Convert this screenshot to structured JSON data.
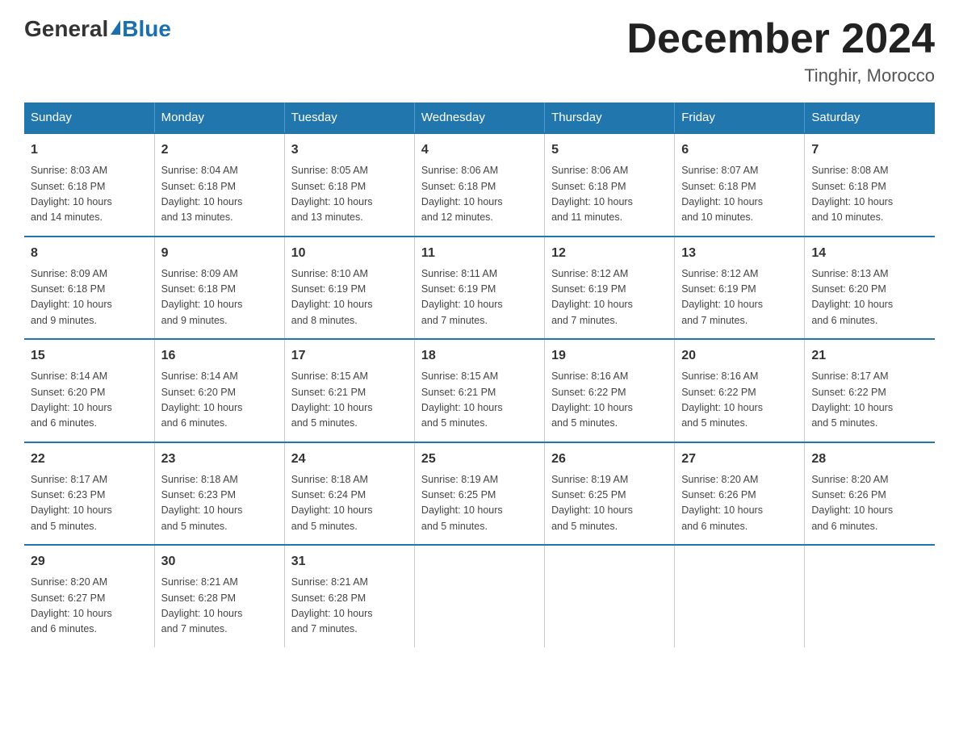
{
  "header": {
    "logo_general": "General",
    "logo_blue": "Blue",
    "month_title": "December 2024",
    "location": "Tinghir, Morocco"
  },
  "weekdays": [
    "Sunday",
    "Monday",
    "Tuesday",
    "Wednesday",
    "Thursday",
    "Friday",
    "Saturday"
  ],
  "weeks": [
    [
      {
        "day": "1",
        "info": "Sunrise: 8:03 AM\nSunset: 6:18 PM\nDaylight: 10 hours\nand 14 minutes."
      },
      {
        "day": "2",
        "info": "Sunrise: 8:04 AM\nSunset: 6:18 PM\nDaylight: 10 hours\nand 13 minutes."
      },
      {
        "day": "3",
        "info": "Sunrise: 8:05 AM\nSunset: 6:18 PM\nDaylight: 10 hours\nand 13 minutes."
      },
      {
        "day": "4",
        "info": "Sunrise: 8:06 AM\nSunset: 6:18 PM\nDaylight: 10 hours\nand 12 minutes."
      },
      {
        "day": "5",
        "info": "Sunrise: 8:06 AM\nSunset: 6:18 PM\nDaylight: 10 hours\nand 11 minutes."
      },
      {
        "day": "6",
        "info": "Sunrise: 8:07 AM\nSunset: 6:18 PM\nDaylight: 10 hours\nand 10 minutes."
      },
      {
        "day": "7",
        "info": "Sunrise: 8:08 AM\nSunset: 6:18 PM\nDaylight: 10 hours\nand 10 minutes."
      }
    ],
    [
      {
        "day": "8",
        "info": "Sunrise: 8:09 AM\nSunset: 6:18 PM\nDaylight: 10 hours\nand 9 minutes."
      },
      {
        "day": "9",
        "info": "Sunrise: 8:09 AM\nSunset: 6:18 PM\nDaylight: 10 hours\nand 9 minutes."
      },
      {
        "day": "10",
        "info": "Sunrise: 8:10 AM\nSunset: 6:19 PM\nDaylight: 10 hours\nand 8 minutes."
      },
      {
        "day": "11",
        "info": "Sunrise: 8:11 AM\nSunset: 6:19 PM\nDaylight: 10 hours\nand 7 minutes."
      },
      {
        "day": "12",
        "info": "Sunrise: 8:12 AM\nSunset: 6:19 PM\nDaylight: 10 hours\nand 7 minutes."
      },
      {
        "day": "13",
        "info": "Sunrise: 8:12 AM\nSunset: 6:19 PM\nDaylight: 10 hours\nand 7 minutes."
      },
      {
        "day": "14",
        "info": "Sunrise: 8:13 AM\nSunset: 6:20 PM\nDaylight: 10 hours\nand 6 minutes."
      }
    ],
    [
      {
        "day": "15",
        "info": "Sunrise: 8:14 AM\nSunset: 6:20 PM\nDaylight: 10 hours\nand 6 minutes."
      },
      {
        "day": "16",
        "info": "Sunrise: 8:14 AM\nSunset: 6:20 PM\nDaylight: 10 hours\nand 6 minutes."
      },
      {
        "day": "17",
        "info": "Sunrise: 8:15 AM\nSunset: 6:21 PM\nDaylight: 10 hours\nand 5 minutes."
      },
      {
        "day": "18",
        "info": "Sunrise: 8:15 AM\nSunset: 6:21 PM\nDaylight: 10 hours\nand 5 minutes."
      },
      {
        "day": "19",
        "info": "Sunrise: 8:16 AM\nSunset: 6:22 PM\nDaylight: 10 hours\nand 5 minutes."
      },
      {
        "day": "20",
        "info": "Sunrise: 8:16 AM\nSunset: 6:22 PM\nDaylight: 10 hours\nand 5 minutes."
      },
      {
        "day": "21",
        "info": "Sunrise: 8:17 AM\nSunset: 6:22 PM\nDaylight: 10 hours\nand 5 minutes."
      }
    ],
    [
      {
        "day": "22",
        "info": "Sunrise: 8:17 AM\nSunset: 6:23 PM\nDaylight: 10 hours\nand 5 minutes."
      },
      {
        "day": "23",
        "info": "Sunrise: 8:18 AM\nSunset: 6:23 PM\nDaylight: 10 hours\nand 5 minutes."
      },
      {
        "day": "24",
        "info": "Sunrise: 8:18 AM\nSunset: 6:24 PM\nDaylight: 10 hours\nand 5 minutes."
      },
      {
        "day": "25",
        "info": "Sunrise: 8:19 AM\nSunset: 6:25 PM\nDaylight: 10 hours\nand 5 minutes."
      },
      {
        "day": "26",
        "info": "Sunrise: 8:19 AM\nSunset: 6:25 PM\nDaylight: 10 hours\nand 5 minutes."
      },
      {
        "day": "27",
        "info": "Sunrise: 8:20 AM\nSunset: 6:26 PM\nDaylight: 10 hours\nand 6 minutes."
      },
      {
        "day": "28",
        "info": "Sunrise: 8:20 AM\nSunset: 6:26 PM\nDaylight: 10 hours\nand 6 minutes."
      }
    ],
    [
      {
        "day": "29",
        "info": "Sunrise: 8:20 AM\nSunset: 6:27 PM\nDaylight: 10 hours\nand 6 minutes."
      },
      {
        "day": "30",
        "info": "Sunrise: 8:21 AM\nSunset: 6:28 PM\nDaylight: 10 hours\nand 7 minutes."
      },
      {
        "day": "31",
        "info": "Sunrise: 8:21 AM\nSunset: 6:28 PM\nDaylight: 10 hours\nand 7 minutes."
      },
      {
        "day": "",
        "info": ""
      },
      {
        "day": "",
        "info": ""
      },
      {
        "day": "",
        "info": ""
      },
      {
        "day": "",
        "info": ""
      }
    ]
  ]
}
